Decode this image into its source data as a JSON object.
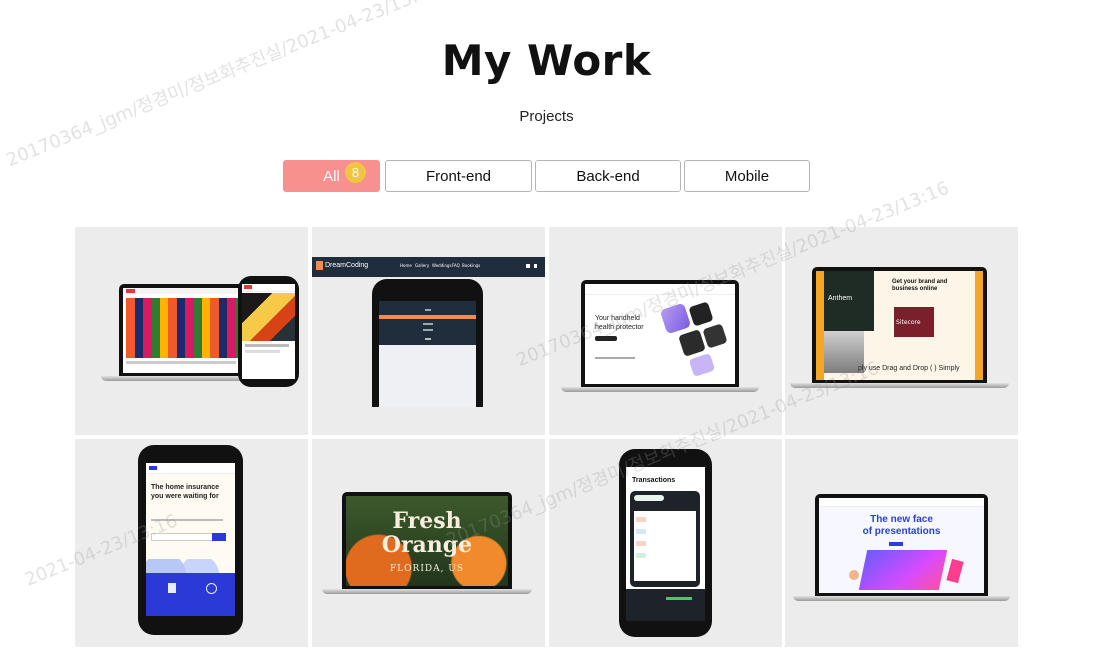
{
  "page": {
    "title": "My Work",
    "subtitle": "Projects"
  },
  "filters": [
    {
      "label": "All",
      "count": "8",
      "active": true
    },
    {
      "label": "Front-end"
    },
    {
      "label": "Back-end"
    },
    {
      "label": "Mobile"
    }
  ],
  "projects": [
    {
      "thumb": "youtube-clone-laptop-phone"
    },
    {
      "thumb": "dreamcoding-portfolio-phone",
      "brand": "DreamCoding",
      "nav": [
        "Home",
        "Gallery",
        "Weddings",
        "FAQ",
        "Bookings"
      ]
    },
    {
      "thumb": "health-protector-laptop",
      "headline": "Your handheld health protector"
    },
    {
      "thumb": "wix-laptop",
      "headline": "Get your brand and business online",
      "caption": "ply use Drag and Drop (  ) Simply",
      "side_label": "Anthem",
      "badge": "Sitecore"
    },
    {
      "thumb": "home-insurance-phone",
      "headline": "The home insurance you were waiting for"
    },
    {
      "thumb": "fresh-orange-laptop",
      "headline_1": "Fresh",
      "headline_2": "Orange",
      "tagline": "FLORIDA, US"
    },
    {
      "thumb": "transactions-phone",
      "headline": "Transactions"
    },
    {
      "thumb": "presentations-laptop",
      "headline_1": "The new face",
      "headline_2": "of presentations"
    }
  ],
  "watermark": {
    "text_1": "20170364_jgm/정경미/정보화추진실/2021-04-23/13:16",
    "text_2": "2021-04-23/13:16"
  },
  "colors": {
    "active_filter": "#f99090",
    "badge": "#f2c444",
    "tile_bg": "#ececec",
    "wix_accent": "#f5a623",
    "presentation_blue": "#2a3fd6"
  }
}
